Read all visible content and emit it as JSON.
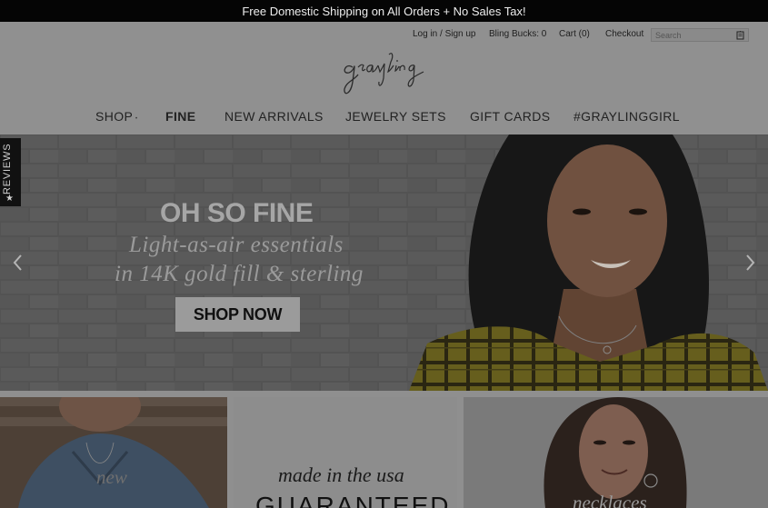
{
  "promo": {
    "text": "Free Domestic Shipping on All Orders + No Sales Tax!"
  },
  "header": {
    "login_label": "Log in / Sign up",
    "bling_label": "Bling Bucks: 0",
    "cart_label": "Cart (0)",
    "checkout_label": "Checkout",
    "search_placeholder": "Search",
    "logo_text": "grayling"
  },
  "nav": {
    "items": [
      {
        "label": "SHOP"
      },
      {
        "label": "FINE"
      },
      {
        "label": "NEW ARRIVALS"
      },
      {
        "label": "JEWELRY SETS"
      },
      {
        "label": "GIFT CARDS"
      },
      {
        "label": "#GRAYLINGGIRL"
      }
    ],
    "dot": "•"
  },
  "hero": {
    "title": "OH SO FINE",
    "line1": "Light-as-air essentials",
    "line2": "in 14K gold fill & sterling",
    "cta": "SHOP NOW"
  },
  "reviews_tab": {
    "label": "REVIEWS"
  },
  "tiles": {
    "left_text": "new",
    "center_line1": "made in the usa",
    "center_line2": "GUARANTEED",
    "right_text": "necklaces"
  },
  "colors": {
    "overlay_gray": "#8f8f8f",
    "promo_bg": "#050505",
    "plaid_yellow": "#6f6620"
  }
}
